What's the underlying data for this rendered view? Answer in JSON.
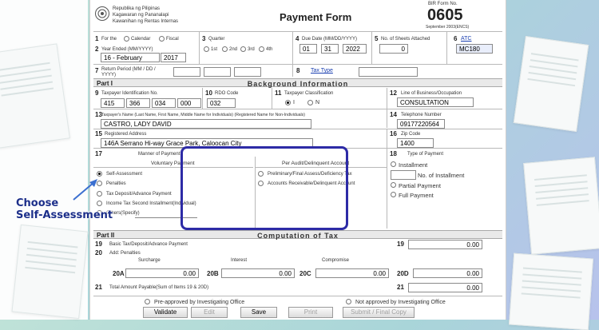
{
  "header": {
    "agency_lines": [
      "Republika ng Pilipinas",
      "Kagawaran ng Pananalapi",
      "Kawanihan ng Rentas Internas"
    ],
    "title": "Payment Form",
    "bir_form_label": "BIR Form No.",
    "form_no": "0605",
    "form_date": "September 2003(ENCS)"
  },
  "item1": {
    "num": "1",
    "label": "For the",
    "options": [
      "Calendar",
      "Fiscal"
    ]
  },
  "item2": {
    "num": "2",
    "label": "Year Ended (MM/YYYY)",
    "month": "16 - February",
    "year": "2017"
  },
  "item3": {
    "num": "3",
    "label": "Quarter",
    "options": [
      "1st",
      "2nd",
      "3rd",
      "4th"
    ]
  },
  "item4": {
    "num": "4",
    "label": "Due Date (MM/DD/YYYY)",
    "mm": "01",
    "dd": "31",
    "yyyy": "2022"
  },
  "item5": {
    "num": "5",
    "label": "No. of Sheets Attached",
    "value": "0"
  },
  "item6": {
    "num": "6",
    "label": "ATC",
    "value": "MC180"
  },
  "item7": {
    "num": "7",
    "label": "Return Period (MM / DD / YYYY)"
  },
  "item8": {
    "num": "8",
    "label": "Tax Type"
  },
  "part1": {
    "label": "Part I",
    "title": "Background Information"
  },
  "item9": {
    "num": "9",
    "label": "Taxpayer Identification No.",
    "tin": [
      "415",
      "366",
      "034",
      "000"
    ]
  },
  "item10": {
    "num": "10",
    "label": "RDO Code",
    "value": "032"
  },
  "item11": {
    "num": "11",
    "label": "Taxpayer Classification",
    "options": [
      "I",
      "N"
    ]
  },
  "item12": {
    "num": "12",
    "label": "Line of Business/Occupation",
    "value": "CONSULTATION"
  },
  "item13": {
    "num": "13",
    "label": "Taxpayer's Name (Last Name, First Name, Middle Name for Individuals) (Registered Name for Non-Individuals)",
    "value": "CASTRO, LADY DAVID"
  },
  "item14": {
    "num": "14",
    "label": "Telephone Number",
    "value": "09177220564"
  },
  "item15": {
    "num": "15",
    "label": "Registered Address",
    "value": "146A Serrano Hi-way Grace Park, Caloocan City"
  },
  "item16": {
    "num": "16",
    "label": "Zip Code",
    "value": "1400"
  },
  "item17": {
    "num": "17",
    "label": "Manner of Payment",
    "voluntary_title": "Voluntary Payment",
    "voluntary_options": [
      "Self-Assessment",
      "Penalties",
      "Tax Deposit/Advance Payment",
      "Income Tax Second Installment(Individual)",
      "Others(Specify)"
    ],
    "audit_title": "Per Audit/Delinquent Account",
    "audit_options": [
      "Preliminary/Final Assess/Deficiency Tax",
      "Accounts Receivable/Delinquent Account"
    ]
  },
  "item18": {
    "num": "18",
    "label": "Type of Payment",
    "installment": "Installment",
    "no_of_installment": "No. of Installment",
    "partial": "Partial Payment",
    "full": "Full Payment"
  },
  "part2": {
    "label": "Part II",
    "title": "Computation of Tax"
  },
  "item19": {
    "num": "19",
    "label": "Basic Tax/Deposit/Advance Payment",
    "value": "0.00"
  },
  "item20": {
    "num": "20",
    "label": "Add: Penalties",
    "surcharge_label": "Surcharge",
    "interest_label": "Interest",
    "compromise_label": "Compromise",
    "a_label": "20A",
    "a_value": "0.00",
    "b_label": "20B",
    "b_value": "0.00",
    "c_label": "20C",
    "c_value": "0.00",
    "d_label": "20D",
    "d_value": "0.00"
  },
  "item21": {
    "num": "21",
    "label": "Total Amount Payable(Sum of Items 19 & 20D)",
    "value": "0.00"
  },
  "approval": {
    "pre": "Pre-approved by Investigating Office",
    "not": "Not approved by Investigating Office"
  },
  "buttons": {
    "validate": "Validate",
    "edit": "Edit",
    "save": "Save",
    "print": "Print",
    "submit": "Submit / Final Copy"
  },
  "callout": {
    "line1": "Choose",
    "line2": "Self-Assessment"
  },
  "colors": {
    "callout": "#2d2ba6",
    "callout_text": "#1c2f8a"
  }
}
